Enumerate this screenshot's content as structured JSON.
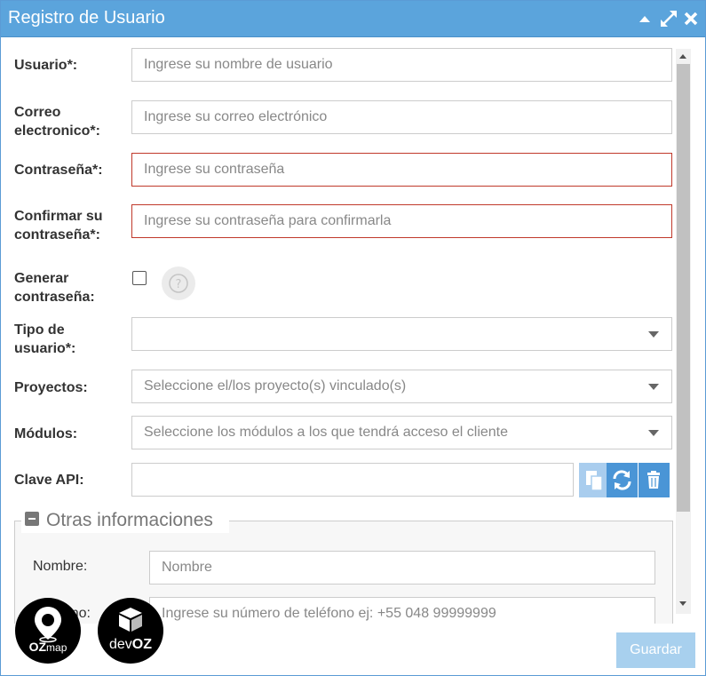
{
  "window": {
    "title": "Registro de Usuario"
  },
  "form": {
    "usuario": {
      "label": "Usuario*:",
      "placeholder": "Ingrese su nombre de usuario"
    },
    "correo": {
      "label_line1": "Correo",
      "label_line2": "electronico*:",
      "placeholder": "Ingrese su correo electrónico"
    },
    "contrasena": {
      "label": "Contraseña*:",
      "placeholder": "Ingrese su contraseña"
    },
    "confirmar": {
      "label_line1": "Confirmar su",
      "label_line2": "contraseña*:",
      "placeholder": "Ingrese su contraseña para confirmarla"
    },
    "generar": {
      "label_line1": "Generar",
      "label_line2": "contraseña:",
      "checked": false,
      "help_icon": "question-circle-icon"
    },
    "tipo": {
      "label_line1": "Tipo de",
      "label_line2": "usuario*:",
      "value": ""
    },
    "proyectos": {
      "label": "Proyectos:",
      "placeholder": "Seleccione el/los proyecto(s) vinculado(s)"
    },
    "modulos": {
      "label": "Módulos:",
      "placeholder": "Seleccione los módulos a los que tendrá acceso el cliente"
    },
    "clave_api": {
      "label": "Clave API:",
      "value": "",
      "buttons": [
        "copy-icon",
        "refresh-icon",
        "trash-icon"
      ]
    }
  },
  "otras": {
    "legend": "Otras informaciones",
    "nombre": {
      "label": "Nombre:",
      "placeholder": "Nombre"
    },
    "telefono": {
      "label": "Teléfono:",
      "placeholder": "Ingrese su número de teléfono ej: +55 048 99999999"
    }
  },
  "footer": {
    "save_label": "Guardar"
  },
  "logos": {
    "ozmap": {
      "text_oz": "OZ",
      "text_map": "map"
    },
    "devoz": {
      "text_dev": "dev",
      "text_oz": "OZ"
    }
  },
  "colors": {
    "titlebar": "#5ba4dc",
    "error_border": "#c0392b",
    "button_blue": "#4a95d6",
    "save_disabled": "#a8d0ee"
  }
}
